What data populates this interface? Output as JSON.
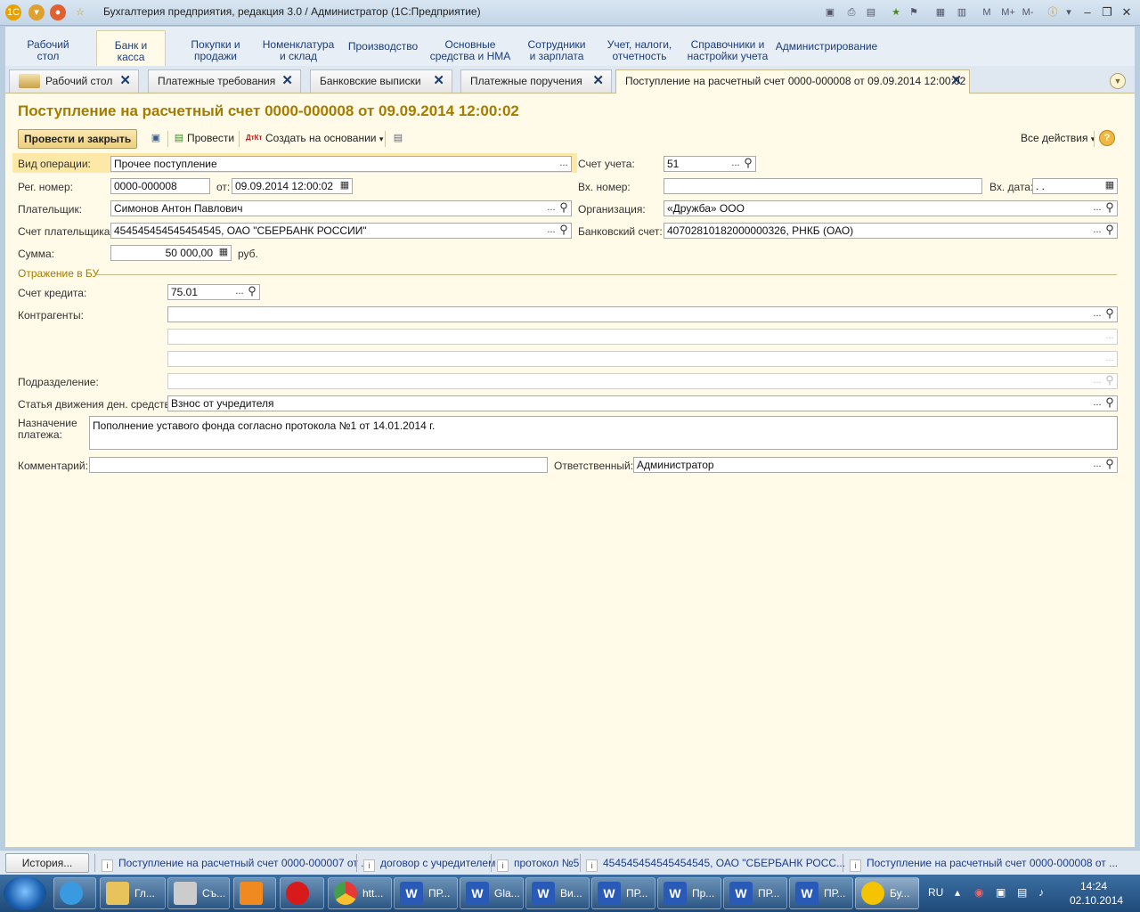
{
  "window": {
    "title": "Бухгалтерия предприятия, редакция 3.0 / Администратор  (1С:Предприятие)",
    "toolbar_right": [
      "M",
      "M+",
      "M-"
    ]
  },
  "menu": [
    {
      "label": "Рабочий\nстол"
    },
    {
      "label": "Банк и\nкасса"
    },
    {
      "label": "Покупки и\nпродажи"
    },
    {
      "label": "Номенклатура\nи склад"
    },
    {
      "label": "Производство"
    },
    {
      "label": "Основные\nсредства и НМА"
    },
    {
      "label": "Сотрудники\nи зарплата"
    },
    {
      "label": "Учет, налоги,\nотчетность"
    },
    {
      "label": "Справочники и\nнастройки учета"
    },
    {
      "label": "Администрирование"
    }
  ],
  "tabs": [
    {
      "label": "Рабочий стол"
    },
    {
      "label": "Платежные требования"
    },
    {
      "label": "Банковские выписки"
    },
    {
      "label": "Платежные поручения"
    },
    {
      "label": "Поступление на расчетный счет 0000-000008 от 09.09.2014 12:00:02"
    }
  ],
  "doc": {
    "title": "Поступление на расчетный счет 0000-000008 от 09.09.2014 12:00:02",
    "toolbar": {
      "post_close": "Провести и закрыть",
      "post": "Провести",
      "create_based": "Создать на основании",
      "all_actions": "Все действия",
      "help": "?"
    },
    "fields": {
      "op_type_label": "Вид операции:",
      "op_type": "Прочее поступление",
      "account_label": "Счет учета:",
      "account": "51",
      "reg_label": "Рег. номер:",
      "reg": "0000-000008",
      "from_label": "от:",
      "date": "09.09.2014 12:00:02",
      "in_num_label": "Вх. номер:",
      "in_num": "",
      "in_date_label": "Вх. дата:",
      "in_date": " .  .",
      "payer_label": "Плательщик:",
      "payer": "Симонов Антон Павлович",
      "org_label": "Организация:",
      "org": "«Дружба» ООО",
      "payer_acc_label": "Счет плательщика:",
      "payer_acc": "454545454545454545, ОАО \"СБЕРБАНК РОССИИ\"",
      "bank_acc_label": "Банковский счет:",
      "bank_acc": "40702810182000000326, РНКБ (ОАО)",
      "sum_label": "Сумма:",
      "sum": "50 000,00",
      "currency": "руб.",
      "group_title": "Отражение в БУ",
      "credit_label": "Счет кредита:",
      "credit": "75.01",
      "contr_label": "Контрагенты:",
      "contr": "",
      "dept_label": "Подразделение:",
      "dept": "",
      "cashflow_label": "Статья движения ден. средств:",
      "cashflow": "Взнос от учредителя",
      "purpose_label": "Назначение\nплатежа:",
      "purpose": "Пополнение уставого фонда согласно протокола №1 от 14.01.2014 г.",
      "comment_label": "Комментарий:",
      "comment": "",
      "resp_label": "Ответственный:",
      "resp": "Администратор"
    }
  },
  "history": {
    "button": "История...",
    "items": [
      "Поступление на расчетный счет 0000-000007 от ...",
      "договор с учредителем",
      "протокол №5",
      "454545454545454545, ОАО \"СБЕРБАНК РОСС...",
      "Поступление на расчетный счет 0000-000008 от ..."
    ]
  },
  "taskbar": {
    "items": [
      "Гл...",
      "Съ...",
      "",
      "",
      "htt...",
      "ПР...",
      "Gla...",
      "Ви...",
      "ПР...",
      "Пр...",
      "ПР...",
      "ПР...",
      "Бу..."
    ],
    "lang": "RU",
    "time": "14:24",
    "date": "02.10.2014"
  },
  "colors": {
    "accent": "#a57b00",
    "link": "#1a3d7a",
    "form_bg": "#fffbe8"
  }
}
